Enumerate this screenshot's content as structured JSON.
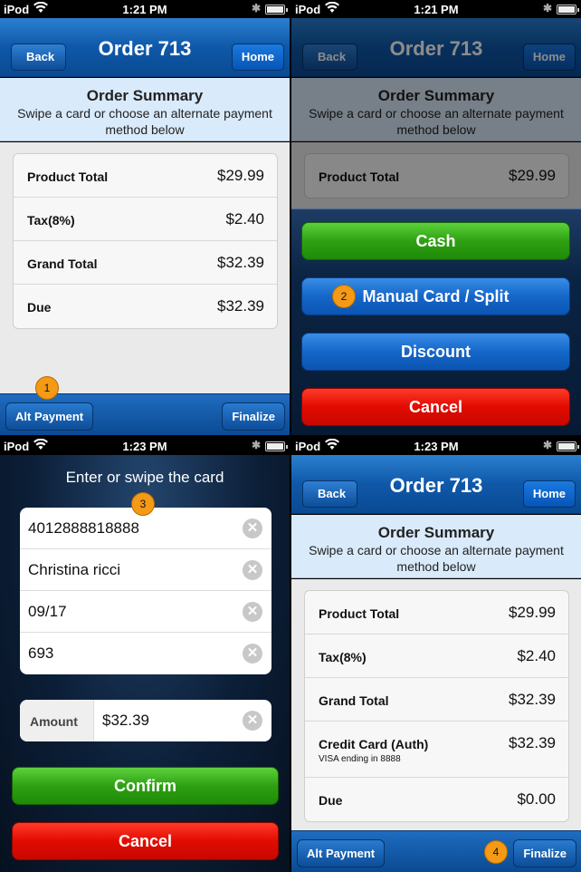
{
  "status_bar": {
    "carrier": "iPod",
    "time_1": "1:21 PM",
    "time_2": "1:23 PM"
  },
  "nav": {
    "back_label": "Back",
    "title": "Order 713",
    "home_label": "Home"
  },
  "summary": {
    "title": "Order Summary",
    "subtitle_line1": "Swipe a card or choose an alternate payment",
    "subtitle_line2": "method below"
  },
  "order_rows": [
    {
      "label": "Product Total",
      "value": "$29.99"
    },
    {
      "label": "Tax(8%)",
      "value": "$2.40"
    },
    {
      "label": "Grand Total",
      "value": "$32.39"
    },
    {
      "label": "Due",
      "value": "$32.39"
    }
  ],
  "final_rows": [
    {
      "label": "Product Total",
      "value": "$29.99"
    },
    {
      "label": "Tax(8%)",
      "value": "$2.40"
    },
    {
      "label": "Grand Total",
      "value": "$32.39"
    },
    {
      "label": "Credit Card (Auth)",
      "value": "$32.39",
      "note": "VISA ending in 8888"
    },
    {
      "label": "Due",
      "value": "$0.00"
    }
  ],
  "tabbar": {
    "alt_payment": "Alt Payment",
    "finalize": "Finalize"
  },
  "payment_sheet": {
    "cash": "Cash",
    "manual": "Manual Card / Split",
    "discount": "Discount",
    "cancel": "Cancel"
  },
  "card_entry": {
    "title": "Enter or swipe the card",
    "card_number": "4012888818888",
    "name": "Christina ricci",
    "expiry": "09/17",
    "cvv": "693",
    "amount_label": "Amount",
    "amount": "$32.39",
    "confirm": "Confirm",
    "cancel": "Cancel",
    "clear_glyph": "✕"
  },
  "steps": [
    "1",
    "2",
    "3",
    "4"
  ],
  "colors": {
    "nav_blue": "#0f58a8",
    "summary_bg": "#d9eafa",
    "green": "#2ea012",
    "red": "#e10b00",
    "badge": "#f49a16"
  }
}
